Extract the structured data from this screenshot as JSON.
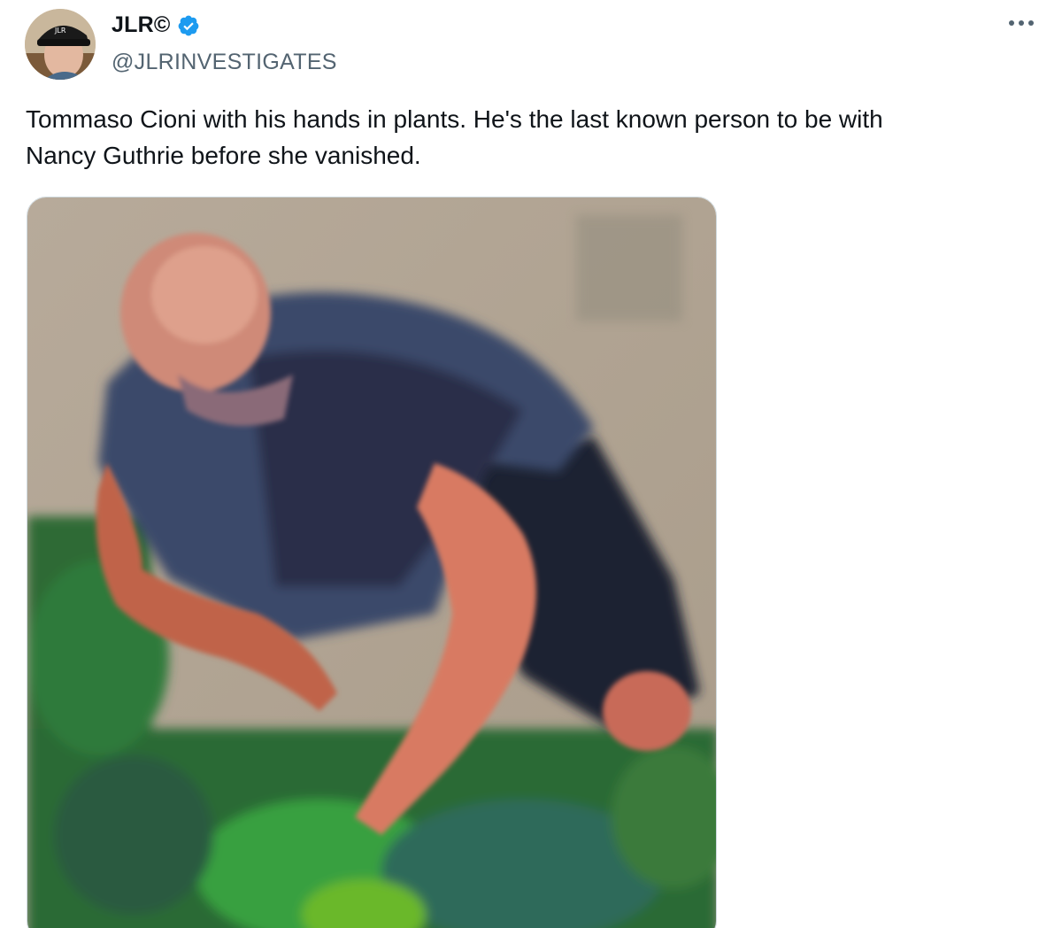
{
  "author": {
    "display_name": "JLR©",
    "handle": "@JLRINVESTIGATES",
    "verified": true,
    "avatar_icon": "profile-photo",
    "avatar_cap_text": "JLR"
  },
  "tweet": {
    "text": "Tommaso Cioni with his hands in plants. He's the last known person to be with\nNancy Guthrie before she vanished."
  },
  "colors": {
    "verified_badge": "#1d9bf0",
    "handle_text": "#536471",
    "primary_text": "#0f1419"
  },
  "icons": {
    "more": "more-horizontal-icon",
    "verified": "verified-badge-icon"
  }
}
